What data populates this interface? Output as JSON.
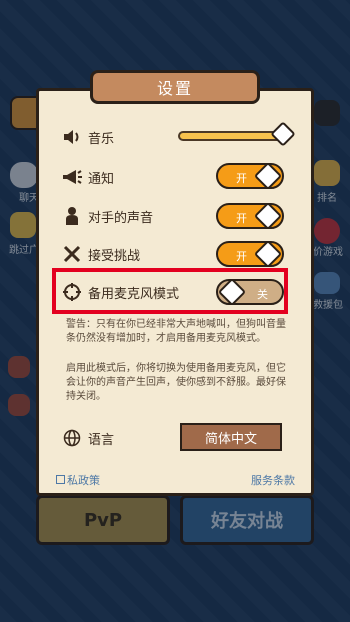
{
  "modal": {
    "title": "设置",
    "rows": {
      "music": "音乐",
      "notify": "通知",
      "opponent_voice": "对手的声音",
      "challenge": "接受挑战",
      "mic_mode": "备用麦克风模式",
      "language": "语言"
    },
    "toggles": {
      "notify": "开",
      "opponent_voice": "开",
      "challenge": "开",
      "mic_mode": "关"
    },
    "music_volume": 1.0,
    "warning1": "警告：只有在你已经非常大声地喊叫，但狗叫音量条仍然没有增加时，才启用备用麦克风模式。",
    "warning2": "启用此模式后，你将切换为使用备用麦克风，但它会让你的声音产生回声，使你感到不舒服。最好保持关闭。",
    "language_value": "简体中文",
    "privacy": "私政策",
    "terms": "服务条款"
  },
  "background": {
    "left": [
      "聊天",
      "跳过广"
    ],
    "right": [
      "排名",
      "价游戏",
      "救援包"
    ],
    "pvp": "PvP",
    "friend_battle": "好友对战"
  },
  "colors": {
    "toggle_on": "#f59c17",
    "toggle_off": "#cfae86",
    "highlight": "#e3001f"
  }
}
